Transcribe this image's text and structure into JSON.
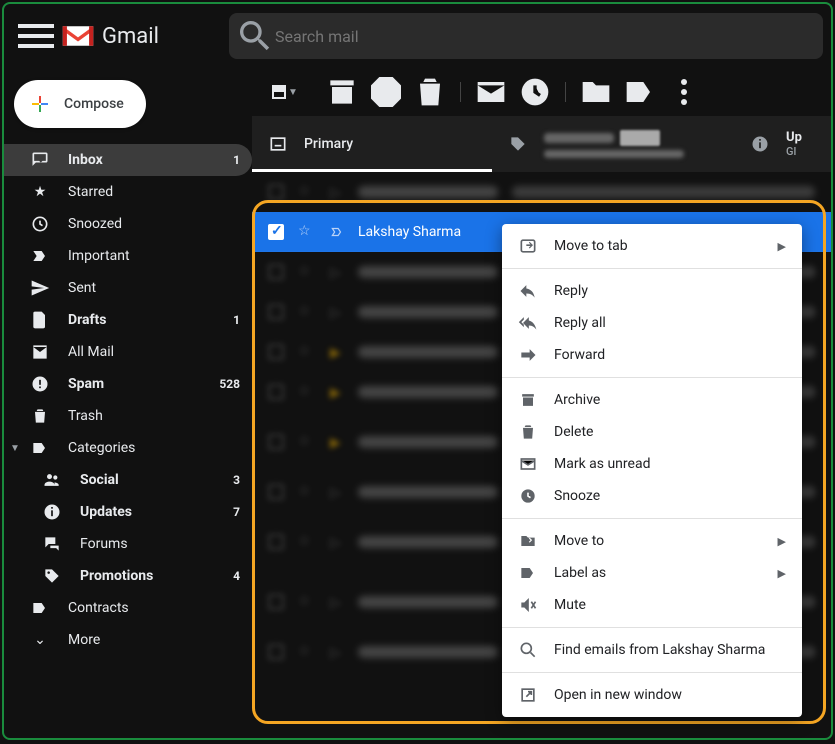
{
  "header": {
    "app_name": "Gmail",
    "search_placeholder": "Search mail"
  },
  "sidebar": {
    "compose_label": "Compose",
    "items": [
      {
        "label": "Inbox",
        "count": "1",
        "icon": "inbox",
        "active": true,
        "bold": true
      },
      {
        "label": "Starred",
        "count": "",
        "icon": "star",
        "active": false,
        "bold": false
      },
      {
        "label": "Snoozed",
        "count": "",
        "icon": "clock",
        "active": false,
        "bold": false
      },
      {
        "label": "Important",
        "count": "",
        "icon": "important",
        "active": false,
        "bold": false
      },
      {
        "label": "Sent",
        "count": "",
        "icon": "send",
        "active": false,
        "bold": false
      },
      {
        "label": "Drafts",
        "count": "1",
        "icon": "file",
        "active": false,
        "bold": true
      },
      {
        "label": "All Mail",
        "count": "",
        "icon": "mail",
        "active": false,
        "bold": false
      },
      {
        "label": "Spam",
        "count": "528",
        "icon": "spam",
        "active": false,
        "bold": true
      },
      {
        "label": "Trash",
        "count": "",
        "icon": "trash",
        "active": false,
        "bold": false
      },
      {
        "label": "Categories",
        "count": "",
        "icon": "label",
        "active": false,
        "bold": false,
        "expandable": true
      }
    ],
    "categories": [
      {
        "label": "Social",
        "count": "3",
        "icon": "people",
        "bold": true
      },
      {
        "label": "Updates",
        "count": "7",
        "icon": "info",
        "bold": true
      },
      {
        "label": "Forums",
        "count": "",
        "icon": "forum",
        "bold": false
      },
      {
        "label": "Promotions",
        "count": "4",
        "icon": "tag",
        "bold": true
      }
    ],
    "extras": [
      {
        "label": "Contracts",
        "count": "",
        "icon": "label-solid"
      },
      {
        "label": "More",
        "count": "",
        "icon": "caret"
      }
    ]
  },
  "tabs": {
    "primary": "Primary",
    "updates_label": "Up",
    "updates_sub": "Gl"
  },
  "selected_email": {
    "sender": "Lakshay Sharma"
  },
  "context_menu": {
    "move_to_tab": "Move to tab",
    "reply": "Reply",
    "reply_all": "Reply all",
    "forward": "Forward",
    "archive": "Archive",
    "delete": "Delete",
    "mark_unread": "Mark as unread",
    "snooze": "Snooze",
    "move_to": "Move to",
    "label_as": "Label as",
    "mute": "Mute",
    "find_emails": "Find emails from Lakshay Sharma",
    "open_new_window": "Open in new window"
  }
}
